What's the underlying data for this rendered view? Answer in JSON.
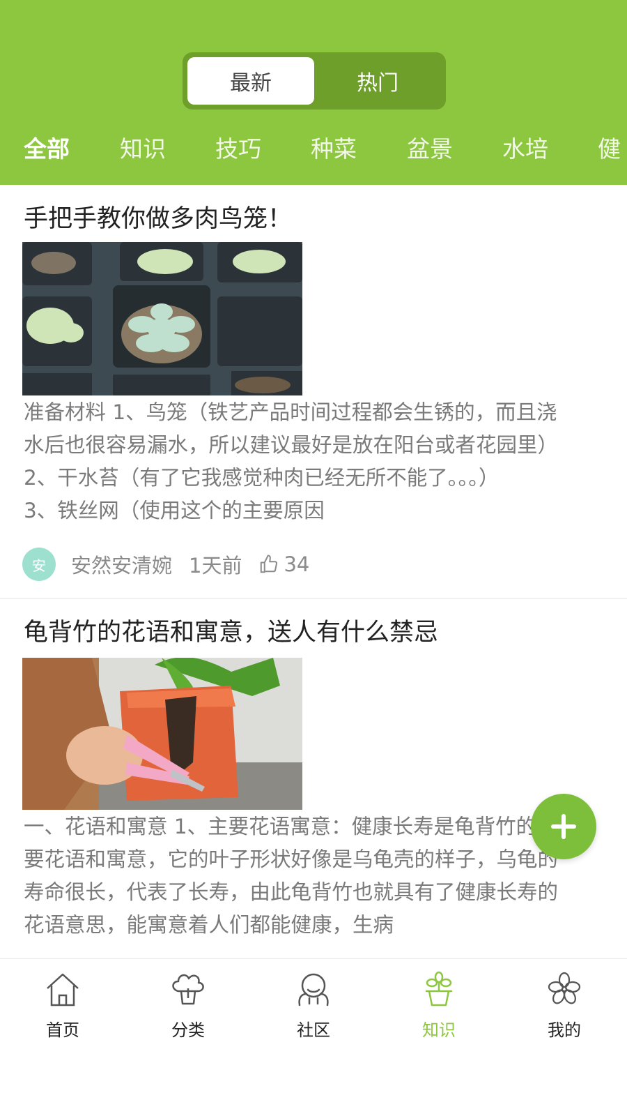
{
  "header": {
    "segments": [
      {
        "label": "最新",
        "active": true
      },
      {
        "label": "热门",
        "active": false
      }
    ],
    "categories": [
      {
        "label": "全部",
        "active": true
      },
      {
        "label": "知识",
        "active": false
      },
      {
        "label": "技巧",
        "active": false
      },
      {
        "label": "种菜",
        "active": false
      },
      {
        "label": "盆景",
        "active": false
      },
      {
        "label": "水培",
        "active": false
      },
      {
        "label": "健",
        "active": false
      }
    ],
    "color": "#8dc63f"
  },
  "articles": [
    {
      "title": "手把手教你做多肉鸟笼！",
      "image": "succulents-in-pots-photo",
      "body_lines": [
        "准备材料 1、鸟笼（铁艺产品时间过程都会生锈的，而且浇",
        "水后也很容易漏水，所以建议最好是放在阳台或者花园里）",
        "2、干水苔（有了它我感觉种肉已经无所不能了。。。）",
        "3、铁丝网（使用这个的主要原因"
      ],
      "author_avatar_text": "安",
      "author": "安然安清婉",
      "time": "1天前",
      "likes": "34"
    },
    {
      "title": "龟背竹的花语和寓意，送人有什么禁忌",
      "image": "cutting-plant-pot-photo",
      "body_lines": [
        "一、花语和寓意 1、主要花语寓意：健康长寿是龟背竹的主",
        "要花语和寓意，它的叶子形状好像是乌龟壳的样子，乌龟的",
        "寿命很长，代表了长寿，由此龟背竹也就具有了健康长寿的",
        "花语意思，能寓意着人们都能健康，生病"
      ]
    }
  ],
  "fab": {
    "icon": "plus-icon"
  },
  "tabbar": {
    "active_color": "#8dc63f",
    "items": [
      {
        "label": "首页",
        "icon": "home-icon",
        "active": false
      },
      {
        "label": "分类",
        "icon": "category-icon",
        "active": false
      },
      {
        "label": "社区",
        "icon": "community-icon",
        "active": false
      },
      {
        "label": "知识",
        "icon": "knowledge-icon",
        "active": true
      },
      {
        "label": "我的",
        "icon": "flower-profile-icon",
        "active": false
      }
    ]
  }
}
